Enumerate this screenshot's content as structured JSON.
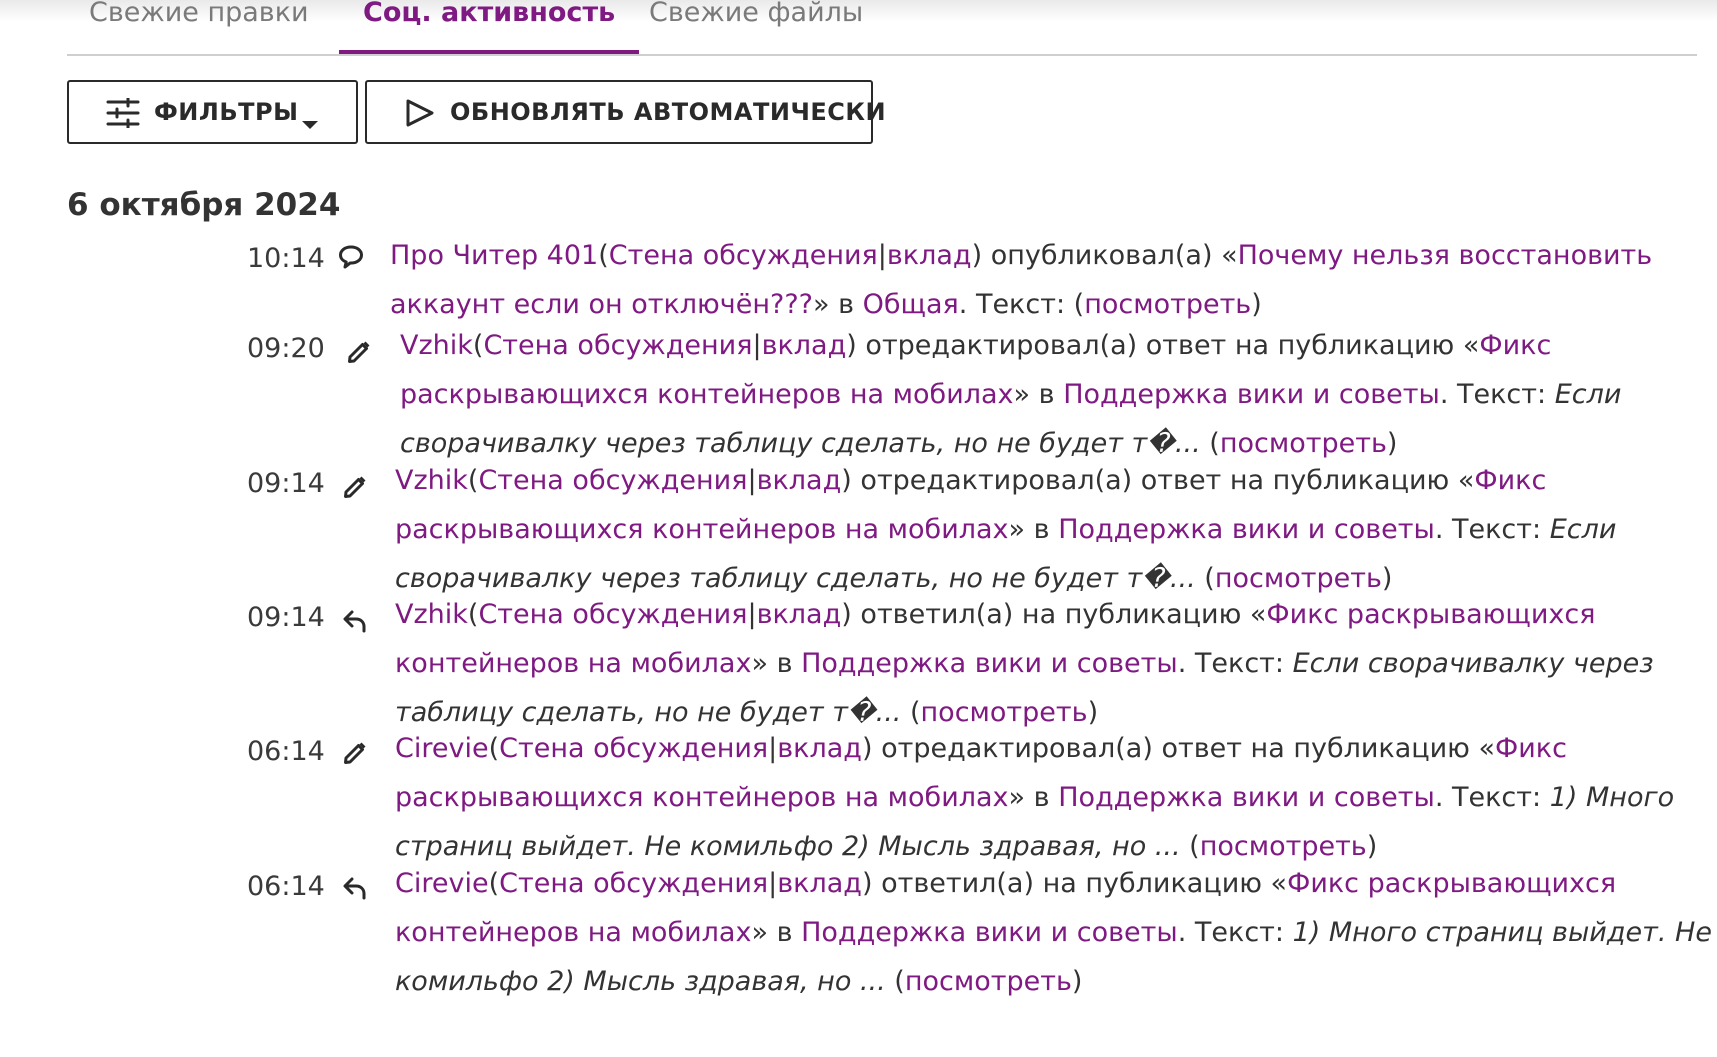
{
  "tabs": [
    {
      "label": "Свежие правки"
    },
    {
      "label": "Соц. активность"
    },
    {
      "label": "Свежие файлы"
    }
  ],
  "colors": {
    "accent": "#7f1a82",
    "text": "#333333",
    "muted": "#7a7a7a"
  },
  "toolbar": {
    "filters_label": "ФИЛЬТРЫ",
    "filters_icon": "sliders-icon",
    "auto_update_label": "ОБНОВЛЯТЬ АВТОМАТИЧЕСКИ",
    "auto_update_icon": "play-icon"
  },
  "date_heading": "6 октября 2024",
  "common": {
    "wall": "Стена обсуждения",
    "sep": "|",
    "contrib": "вклад",
    "view": "посмотреть",
    "in": "в",
    "text_label": "Текст:"
  },
  "entries": [
    {
      "time": "10:14",
      "icon": "speech-bubble-icon",
      "user": "Про Читер 401",
      "action": "опубликовал(а) «",
      "post_a": "Почему нельзя восстановить",
      "post_b": "аккаунт если он отключён???",
      "forum": "Общая",
      "excerpt_a": "",
      "excerpt_b": ""
    },
    {
      "time": "09:20",
      "icon": "pencil-icon",
      "user": "Vzhik",
      "action": "отредактировал(а) ответ на публикацию «",
      "post_a": "Фикс",
      "post_b": "раскрывающихся контейнеров на мобилах",
      "forum": "Поддержка вики и советы",
      "excerpt_a": "Если",
      "excerpt_b": "сворачивалку через таблицу сделать, но не будет т�..."
    },
    {
      "time": "09:14",
      "icon": "pencil-icon",
      "user": "Vzhik",
      "action": "отредактировал(а) ответ на публикацию «",
      "post_a": "Фикс",
      "post_b": "раскрывающихся контейнеров на мобилах",
      "forum": "Поддержка вики и советы",
      "excerpt_a": "Если",
      "excerpt_b": "сворачивалку через таблицу сделать, но не будет т�..."
    },
    {
      "time": "09:14",
      "icon": "reply-icon",
      "user": "Vzhik",
      "action": "ответил(а) на публикацию «",
      "post_a": "Фикс раскрывающихся",
      "post_b": "контейнеров на мобилах",
      "forum": "Поддержка вики и советы",
      "excerpt_a": "Если сворачивалку через",
      "excerpt_b": "таблицу сделать, но не будет т�..."
    },
    {
      "time": "06:14",
      "icon": "pencil-icon",
      "user": "Cirevie",
      "action": "отредактировал(а) ответ на публикацию «",
      "post_a": "Фикс",
      "post_b": "раскрывающихся контейнеров на мобилах",
      "forum": "Поддержка вики и советы",
      "excerpt_a": "1) Много",
      "excerpt_b": "страниц выйдет. Не комильфо 2) Мысль здравая, но ..."
    },
    {
      "time": "06:14",
      "icon": "reply-icon",
      "user": "Cirevie",
      "action": "ответил(а) на публикацию «",
      "post_a": "Фикс раскрывающихся",
      "post_b": "контейнеров на мобилах",
      "forum": "Поддержка вики и советы",
      "excerpt_a": "1) Много страниц выйдет. Не",
      "excerpt_b": "комильфо 2) Мысль здравая, но ..."
    }
  ]
}
